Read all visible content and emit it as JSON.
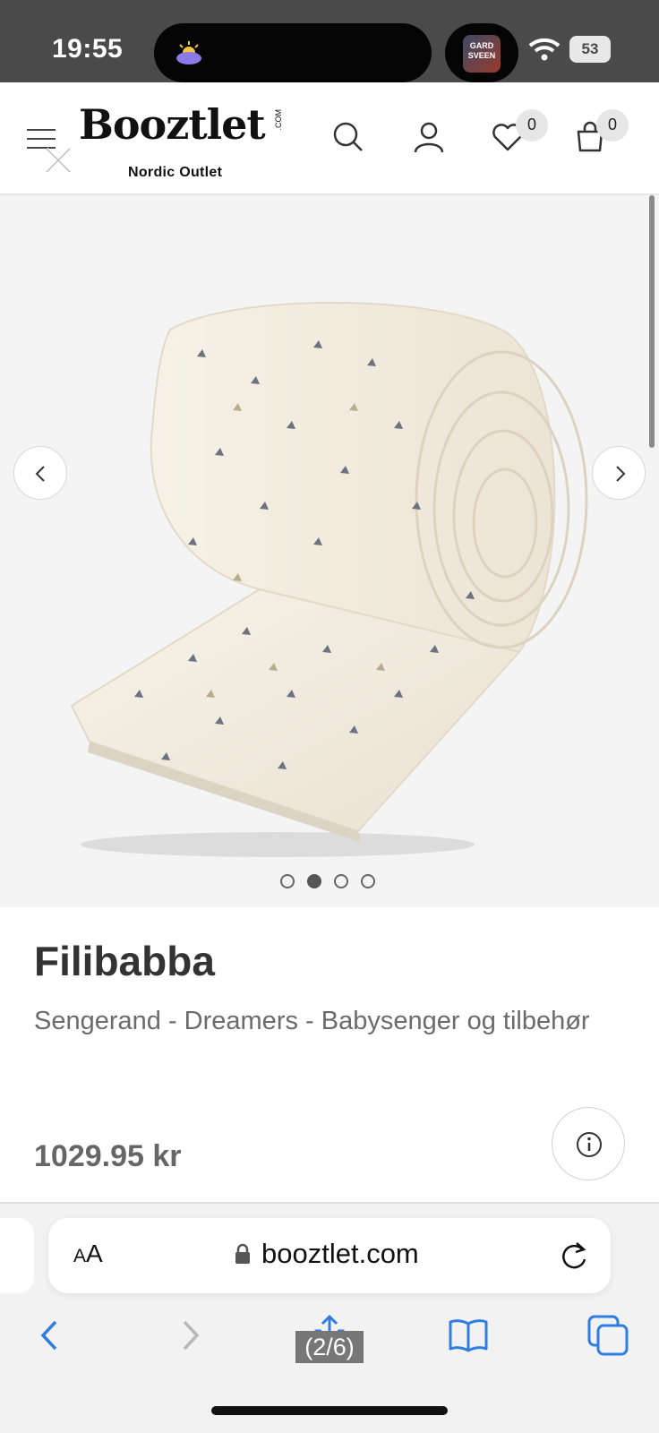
{
  "status_bar": {
    "time": "19:55",
    "podcast_label": "GARD SVEEN",
    "battery": "53"
  },
  "header": {
    "logo": "Booztlet",
    "logo_com": ".COM",
    "logo_sub": "Nordic Outlet",
    "wishlist_count": "0",
    "cart_count": "0"
  },
  "gallery": {
    "image_count": 4,
    "active_index": 1
  },
  "product": {
    "brand": "Filibabba",
    "subtitle": "Sengerand - Dreamers - Babysenger og tilbehør",
    "price": "1029.95 kr"
  },
  "browser": {
    "aa_small": "A",
    "aa_large": "A",
    "url": "booztlet.com",
    "page_counter": "(2/6)",
    "accent_color": "#2f7de1"
  },
  "icons": {
    "menu": "hamburger-icon",
    "close": "close-icon",
    "search": "search-icon",
    "account": "user-icon",
    "wishlist": "heart-icon",
    "cart": "shopping-bag-icon",
    "info": "info-icon"
  }
}
